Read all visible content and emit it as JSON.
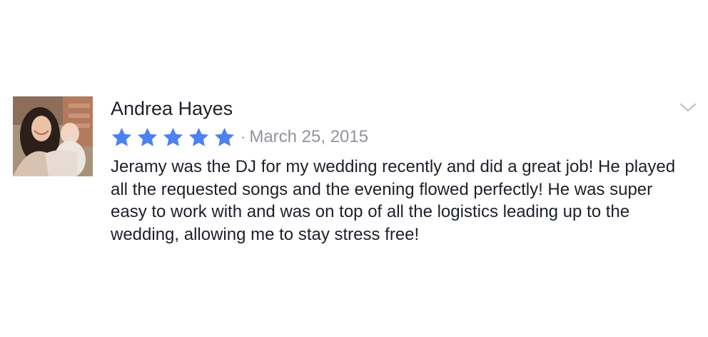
{
  "review": {
    "reviewer_name": "Andrea Hayes",
    "rating": 5,
    "rating_max": 5,
    "separator": "·",
    "date": "March 25, 2015",
    "text": "Jeramy was the DJ for my wedding recently and did a great job! He played all the requested songs and the evening flowed perfectly! He was super easy to work with and was on top of all the logistics leading up to the wedding, allowing me to stay stress free!",
    "options_icon": "chevron-down-icon",
    "star_icon": "star-icon"
  },
  "colors": {
    "star": "#4c81f0",
    "name_text": "#1d2129",
    "meta_text": "#90949c",
    "chevron": "#bec3c9"
  }
}
